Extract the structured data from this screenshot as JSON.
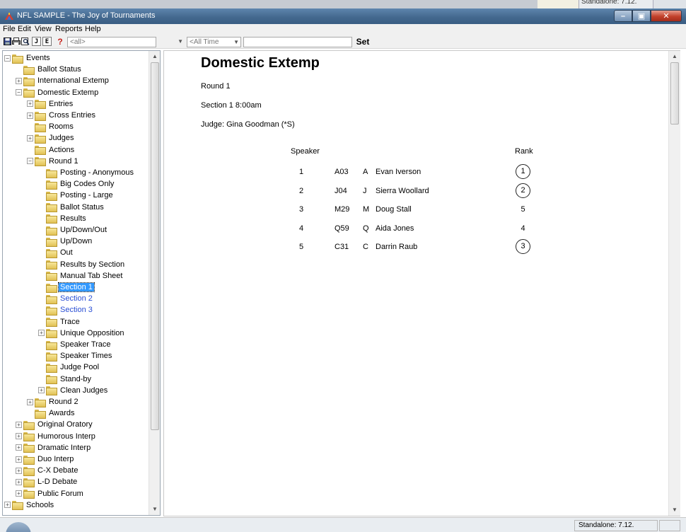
{
  "top_caption": "Standalone: 7.12.",
  "window": {
    "title": "NFL SAMPLE - The Joy of Tournaments",
    "minimize": "–",
    "maximize": "▣",
    "close": "✕"
  },
  "menu": [
    "File",
    "Edit",
    "View",
    "Reports",
    "Help"
  ],
  "toolbar": {
    "box_j": "J",
    "box_e": "E",
    "help": "?",
    "filter_value": "<all>",
    "time_value": "<All Time",
    "set_label": "Set"
  },
  "tree": [
    {
      "label": "Events",
      "expander": "−"
    },
    {
      "label": "Ballot Status"
    },
    {
      "label": "International Extemp",
      "expander": "+"
    },
    {
      "label": "Domestic Extemp",
      "expander": "−"
    },
    {
      "label": "Entries",
      "expander": "+"
    },
    {
      "label": "Cross Entries",
      "expander": "+"
    },
    {
      "label": "Rooms"
    },
    {
      "label": "Judges",
      "expander": "+"
    },
    {
      "label": "Actions"
    },
    {
      "label": "Round 1",
      "expander": "−"
    },
    {
      "label": "Posting - Anonymous"
    },
    {
      "label": "Big Codes Only"
    },
    {
      "label": "Posting - Large"
    },
    {
      "label": "Ballot Status"
    },
    {
      "label": "Results"
    },
    {
      "label": "Up/Down/Out"
    },
    {
      "label": "Up/Down"
    },
    {
      "label": "Out"
    },
    {
      "label": "Results by Section"
    },
    {
      "label": "Manual Tab Sheet"
    },
    {
      "label": "Section 1",
      "selected": true
    },
    {
      "label": "Section 2",
      "link": true
    },
    {
      "label": "Section 3",
      "link": true
    },
    {
      "label": "Trace"
    },
    {
      "label": "Unique Opposition",
      "expander": "+"
    },
    {
      "label": "Speaker Trace"
    },
    {
      "label": "Speaker Times"
    },
    {
      "label": "Judge Pool"
    },
    {
      "label": "Stand-by"
    },
    {
      "label": "Clean Judges",
      "expander": "+"
    },
    {
      "label": "Round 2",
      "expander": "+"
    },
    {
      "label": "Awards"
    },
    {
      "label": "Original Oratory",
      "expander": "+"
    },
    {
      "label": "Humorous Interp",
      "expander": "+"
    },
    {
      "label": "Dramatic Interp",
      "expander": "+"
    },
    {
      "label": "Duo Interp",
      "expander": "+"
    },
    {
      "label": "C-X Debate",
      "expander": "+"
    },
    {
      "label": "L-D Debate",
      "expander": "+"
    },
    {
      "label": "Public Forum",
      "expander": "+"
    },
    {
      "label": "Schools",
      "expander": "+"
    }
  ],
  "document": {
    "title": "Domestic Extemp",
    "round": "Round 1",
    "section": "Section 1   8:00am",
    "judge": "Judge: Gina Goodman (*S)",
    "speaker_header": "Speaker",
    "rank_header": "Rank",
    "rows": [
      {
        "speaker": "1",
        "code": "A03",
        "letter": "A",
        "name": "Evan Iverson",
        "rank": "1",
        "circled": true
      },
      {
        "speaker": "2",
        "code": "J04",
        "letter": "J",
        "name": "Sierra Woollard",
        "rank": "2",
        "circled": true
      },
      {
        "speaker": "3",
        "code": "M29",
        "letter": "M",
        "name": "Doug Stall",
        "rank": "5",
        "circled": false
      },
      {
        "speaker": "4",
        "code": "Q59",
        "letter": "Q",
        "name": "Aida Jones",
        "rank": "4",
        "circled": false
      },
      {
        "speaker": "5",
        "code": "C31",
        "letter": "C",
        "name": "Darrin Raub",
        "rank": "3",
        "circled": true
      }
    ]
  },
  "status": {
    "version": "Standalone: 7.12."
  },
  "colors": {
    "titlebar": "#44698f",
    "selection": "#3399ff",
    "link": "#2a4fd4",
    "folder": "#e1c154"
  }
}
